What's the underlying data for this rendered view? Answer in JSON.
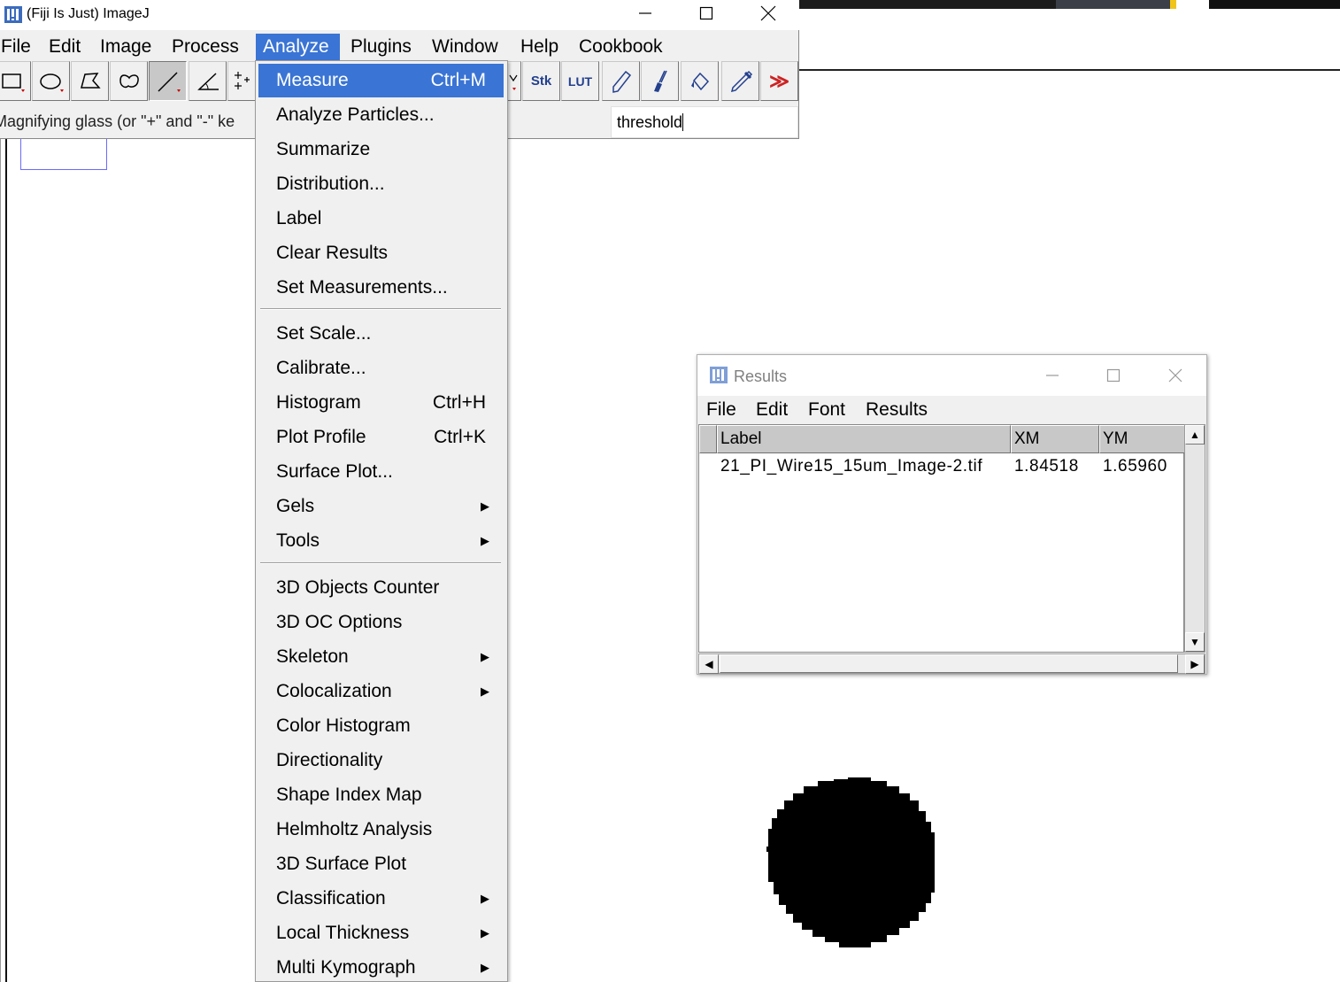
{
  "main_window": {
    "title": "(Fiji Is Just) ImageJ",
    "menus": [
      {
        "label": "File"
      },
      {
        "label": "Edit"
      },
      {
        "label": "Image"
      },
      {
        "label": "Process"
      },
      {
        "label": "Analyze"
      },
      {
        "label": "Plugins"
      },
      {
        "label": "Window"
      },
      {
        "label": "Help"
      },
      {
        "label": "Cookbook"
      }
    ],
    "active_menu": "Analyze",
    "toolbar": {
      "tools": [
        "rectangle-tool",
        "oval-tool",
        "polygon-tool",
        "freehand-tool",
        "line-tool",
        "angle-tool",
        "point-tool",
        "dropdown-arrow",
        "stacks-tool",
        "lut-tool",
        "pencil-tool",
        "brush-tool",
        "flood-fill-tool",
        "pipette-tool",
        "more-tools"
      ],
      "stk_label": "Stk",
      "lut_label": "LUT",
      "more_label": "≫"
    },
    "status_text": "Magnifying glass (or \"+\" and \"-\" ke",
    "search_value": "threshold"
  },
  "analyze_menu": {
    "items": [
      {
        "label": "Measure",
        "shortcut": "Ctrl+M",
        "highlighted": true
      },
      {
        "label": "Analyze Particles..."
      },
      {
        "label": "Summarize"
      },
      {
        "label": "Distribution..."
      },
      {
        "label": "Label"
      },
      {
        "label": "Clear Results"
      },
      {
        "label": "Set Measurements..."
      },
      {
        "label": "Set Scale..."
      },
      {
        "label": "Calibrate..."
      },
      {
        "label": "Histogram",
        "shortcut": "Ctrl+H"
      },
      {
        "label": "Plot Profile",
        "shortcut": "Ctrl+K"
      },
      {
        "label": "Surface Plot..."
      },
      {
        "label": "Gels",
        "submenu": true
      },
      {
        "label": "Tools",
        "submenu": true
      },
      {
        "label": "3D Objects Counter"
      },
      {
        "label": "3D OC Options"
      },
      {
        "label": "Skeleton",
        "submenu": true
      },
      {
        "label": "Colocalization",
        "submenu": true
      },
      {
        "label": "Color Histogram"
      },
      {
        "label": "Directionality"
      },
      {
        "label": "Shape Index Map"
      },
      {
        "label": "Helmholtz Analysis"
      },
      {
        "label": "3D Surface Plot"
      },
      {
        "label": "Classification",
        "submenu": true
      },
      {
        "label": "Local Thickness",
        "submenu": true
      },
      {
        "label": "Multi Kymograph",
        "submenu": true
      }
    ]
  },
  "results_window": {
    "title": "Results",
    "menus": [
      {
        "label": "File"
      },
      {
        "label": "Edit"
      },
      {
        "label": "Font"
      },
      {
        "label": "Results"
      }
    ],
    "columns": [
      "Label",
      "XM",
      "YM"
    ],
    "rows": [
      [
        "21_PI_Wire15_15um_Image-2.tif",
        "1.84518",
        "1.65960"
      ]
    ]
  },
  "colors": {
    "menu_highlight": "#3a74d4",
    "window_bg": "#f0f0f0",
    "icon_blue": "#23408e",
    "more_red": "#cc2222"
  }
}
